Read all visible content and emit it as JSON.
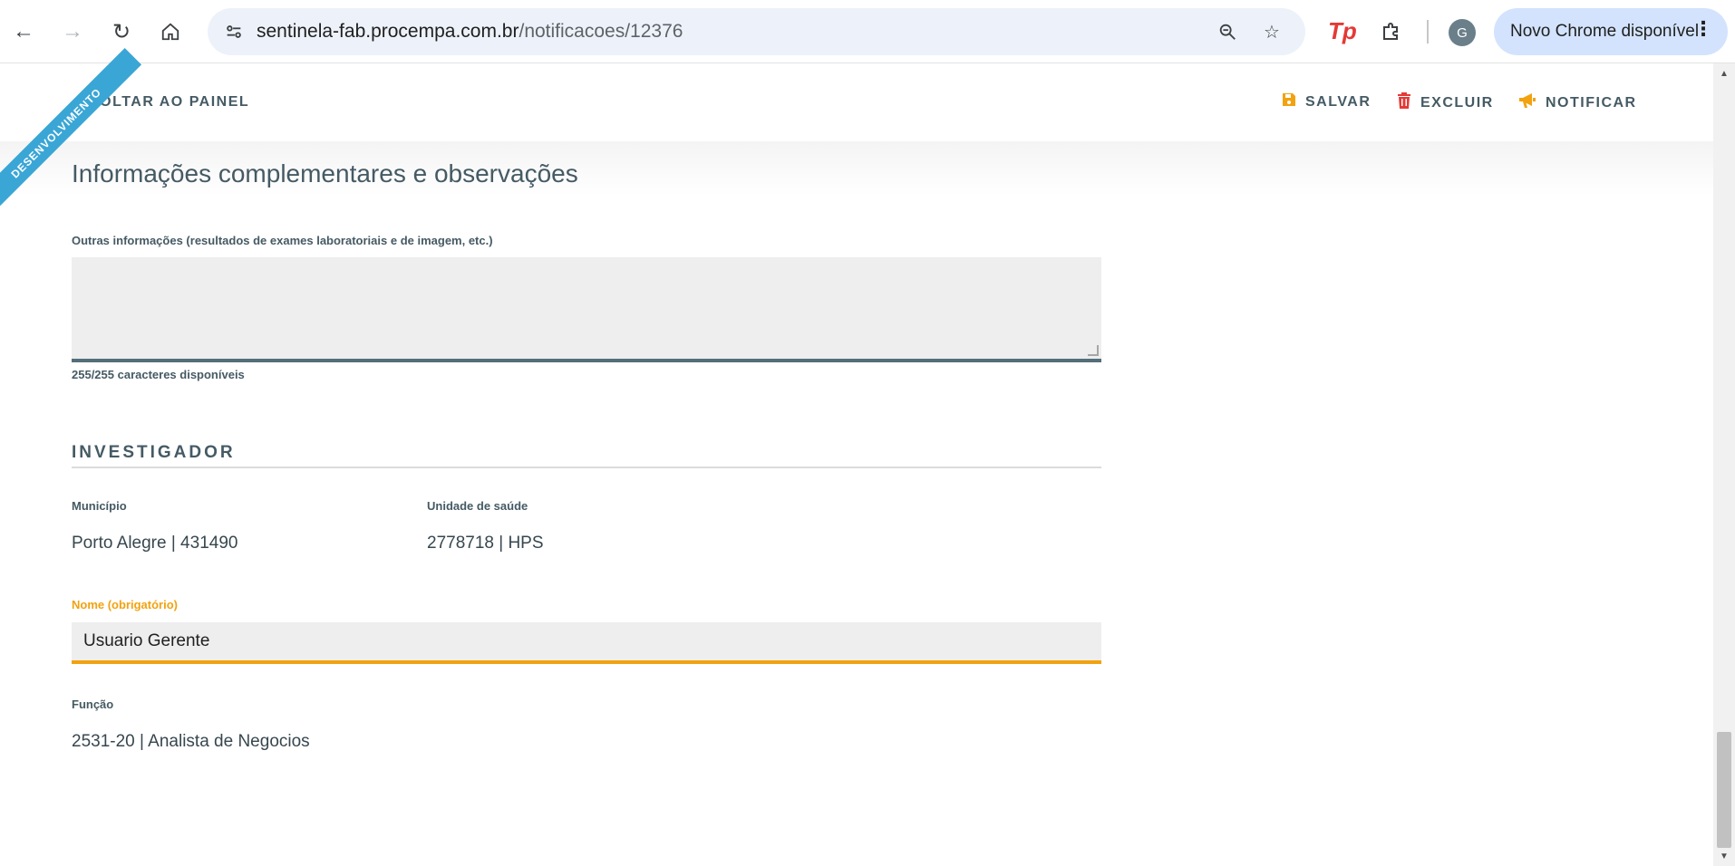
{
  "browser": {
    "url_host": "sentinela-fab.procempa.com.br",
    "url_path": "/notificacoes/12376",
    "avatar_letter": "G",
    "update_label": "Novo Chrome disponível",
    "ext_tp": "Tp"
  },
  "page": {
    "ribbon": "DESENVOLVIMENTO",
    "back_label": "VOLTAR AO PAINEL",
    "actions": {
      "save": "SALVAR",
      "delete": "EXCLUIR",
      "notify": "NOTIFICAR"
    },
    "section_title": "Informações complementares e observações",
    "other_info": {
      "label": "Outras informações (resultados de exames laboratoriais e de imagem, etc.)",
      "value": "",
      "counter": "255/255 caracteres disponíveis"
    },
    "investigator": {
      "title": "INVESTIGADOR",
      "municipality_label": "Município",
      "municipality_value": "Porto Alegre | 431490",
      "health_unit_label": "Unidade de saúde",
      "health_unit_value": "2778718 | HPS",
      "name_label": "Nome (obrigatório)",
      "name_value": "Usuario Gerente",
      "role_label": "Função",
      "role_value": "2531-20 | Analista de Negocios"
    }
  },
  "colors": {
    "accent_orange": "#f2a20f",
    "delete_red": "#e53935",
    "text_slate": "#455a64",
    "ribbon_blue": "#3aa6d6"
  }
}
